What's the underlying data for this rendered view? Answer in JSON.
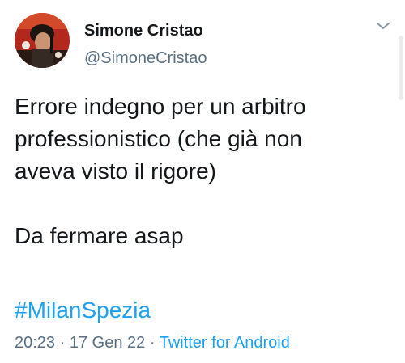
{
  "author": {
    "display_name": "Simone Cristao",
    "handle": "@SimoneCristao"
  },
  "tweet": {
    "lines": [
      "Errore indegno per un arbitro",
      "professionistico (che già non",
      "aveva visto il rigore)"
    ],
    "second_paragraph": "Da fermare asap",
    "hashtag": "#MilanSpezia"
  },
  "meta": {
    "time": "20:23",
    "separator": " · ",
    "date": "17 Gen 22",
    "source": "Twitter for Android"
  },
  "colors": {
    "link": "#1da1f2",
    "secondary_text": "#5b7083",
    "primary_text": "#14171a"
  },
  "icons": {
    "menu": "chevron-down-icon"
  }
}
